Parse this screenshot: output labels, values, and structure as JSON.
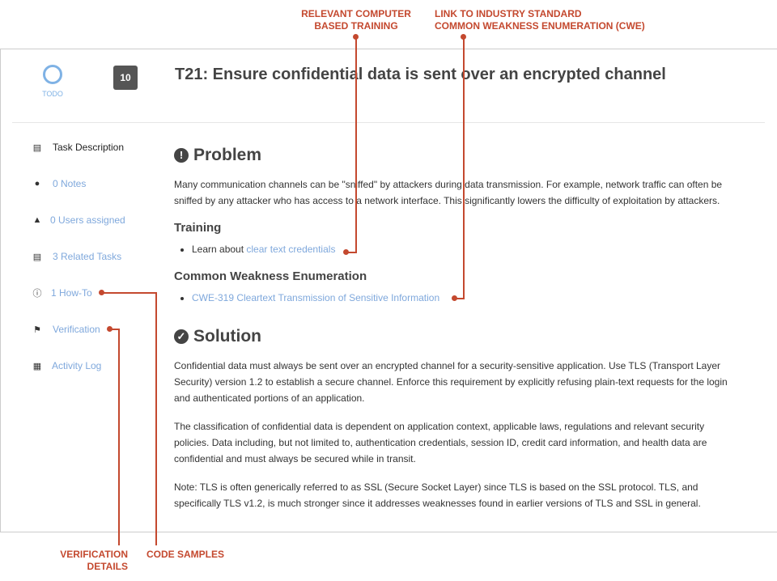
{
  "task": {
    "status": "TODO",
    "badge": "10",
    "title": "T21: Ensure confidential data is sent over an encrypted channel"
  },
  "nav": [
    {
      "label": "Task Description",
      "icon": "list-icon"
    },
    {
      "label": "0 Notes",
      "icon": "comments-icon"
    },
    {
      "label": "0 Users assigned",
      "icon": "user-icon"
    },
    {
      "label": "3 Related Tasks",
      "icon": "list-icon"
    },
    {
      "label": "1 How-To",
      "icon": "info-icon"
    },
    {
      "label": "Verification",
      "icon": "flag-icon"
    },
    {
      "label": "Activity Log",
      "icon": "calendar-icon"
    }
  ],
  "problem": {
    "heading": "Problem",
    "text": "Many communication channels can be \"sniffed\" by attackers during data transmission. For example, network traffic can often be sniffed by any attacker who has access to a network interface. This significantly lowers the difficulty of exploitation by attackers.",
    "training_heading": "Training",
    "training_prefix": "Learn about ",
    "training_link": "clear text credentials",
    "cwe_heading": "Common Weakness Enumeration",
    "cwe_link": "CWE-319 Cleartext Transmission of Sensitive Information"
  },
  "solution": {
    "heading": "Solution",
    "paragraphs": [
      "Confidential data must always be sent over an encrypted channel for a security-sensitive application. Use TLS (Transport Layer Security) version 1.2 to establish a secure channel. Enforce this requirement by explicitly refusing plain-text requests for the login and authenticated portions of an application.",
      "The classification of confidential data is dependent on application context, applicable laws, regulations and relevant security policies. Data including, but not limited to, authentication credentials, session ID, credit card information, and health data are confidential and must always be secured while in transit.",
      "Note: TLS is often generically referred to as SSL (Secure Socket Layer) since TLS is based on the SSL protocol. TLS, and specifically TLS v1.2, is much stronger since it addresses weaknesses found in earlier versions of TLS and SSL in general."
    ]
  },
  "callouts": {
    "training": [
      "RELEVANT COMPUTER",
      "BASED TRAINING"
    ],
    "cwe": [
      "LINK TO INDUSTRY STANDARD",
      "COMMON WEAKNESS ENUMERATION (CWE)"
    ],
    "verification": [
      "VERIFICATION",
      "DETAILS"
    ],
    "code": [
      "CODE SAMPLES"
    ]
  },
  "colors": {
    "callout": "#c4492f",
    "link": "#7fa8dc",
    "status": "#7fb2e5"
  }
}
